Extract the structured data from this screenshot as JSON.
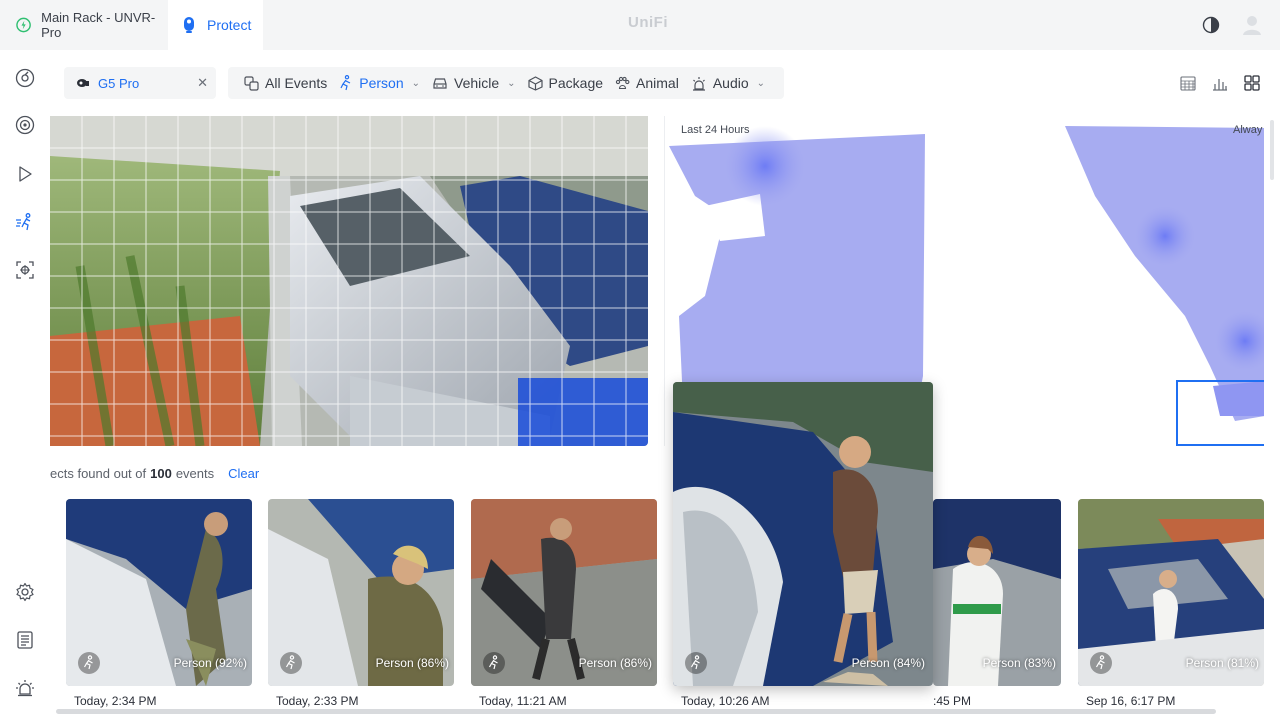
{
  "topbar": {
    "site_name": "Main Rack - UNVR-Pro",
    "app_tab": "Protect",
    "brand": "UniFi"
  },
  "filters": {
    "camera": "G5 Pro",
    "all_events": "All Events",
    "person": "Person",
    "vehicle": "Vehicle",
    "package": "Package",
    "animal": "Animal",
    "audio": "Audio"
  },
  "heatmap": {
    "range_label": "Last 24 Hours",
    "mode_label": "Alway"
  },
  "results": {
    "prefix": "ects found out of",
    "total": "100",
    "suffix": "events",
    "clear": "Clear"
  },
  "events": [
    {
      "label": "Person (92%)",
      "time": "Today, 2:34 PM"
    },
    {
      "label": "Person (86%)",
      "time": "Today, 2:33 PM"
    },
    {
      "label": "Person (86%)",
      "time": "Today, 11:21 AM"
    },
    {
      "label": "Person (84%)",
      "time": "Today, 10:26 AM"
    },
    {
      "label": "Person (83%)",
      "time": ":45 PM"
    },
    {
      "label": "Person (81%)",
      "time": "Sep 16, 6:17 PM"
    }
  ],
  "colors": {
    "accent": "#1f6ff2",
    "heatmap": "#8f96f2",
    "selection": "#1c4fd8"
  },
  "icons": [
    "unifi-status-icon",
    "protect-camera-icon",
    "theme-toggle-icon",
    "user-avatar-icon",
    "dashboard-icon",
    "devices-icon",
    "play-icon",
    "detections-icon",
    "alignment-icon",
    "settings-icon",
    "logs-icon",
    "alarm-icon",
    "camera-icon",
    "close-icon",
    "all-events-icon",
    "person-icon",
    "vehicle-icon",
    "package-icon",
    "animal-icon",
    "audio-icon",
    "calendar-view-icon",
    "chart-view-icon",
    "grid-view-icon"
  ]
}
